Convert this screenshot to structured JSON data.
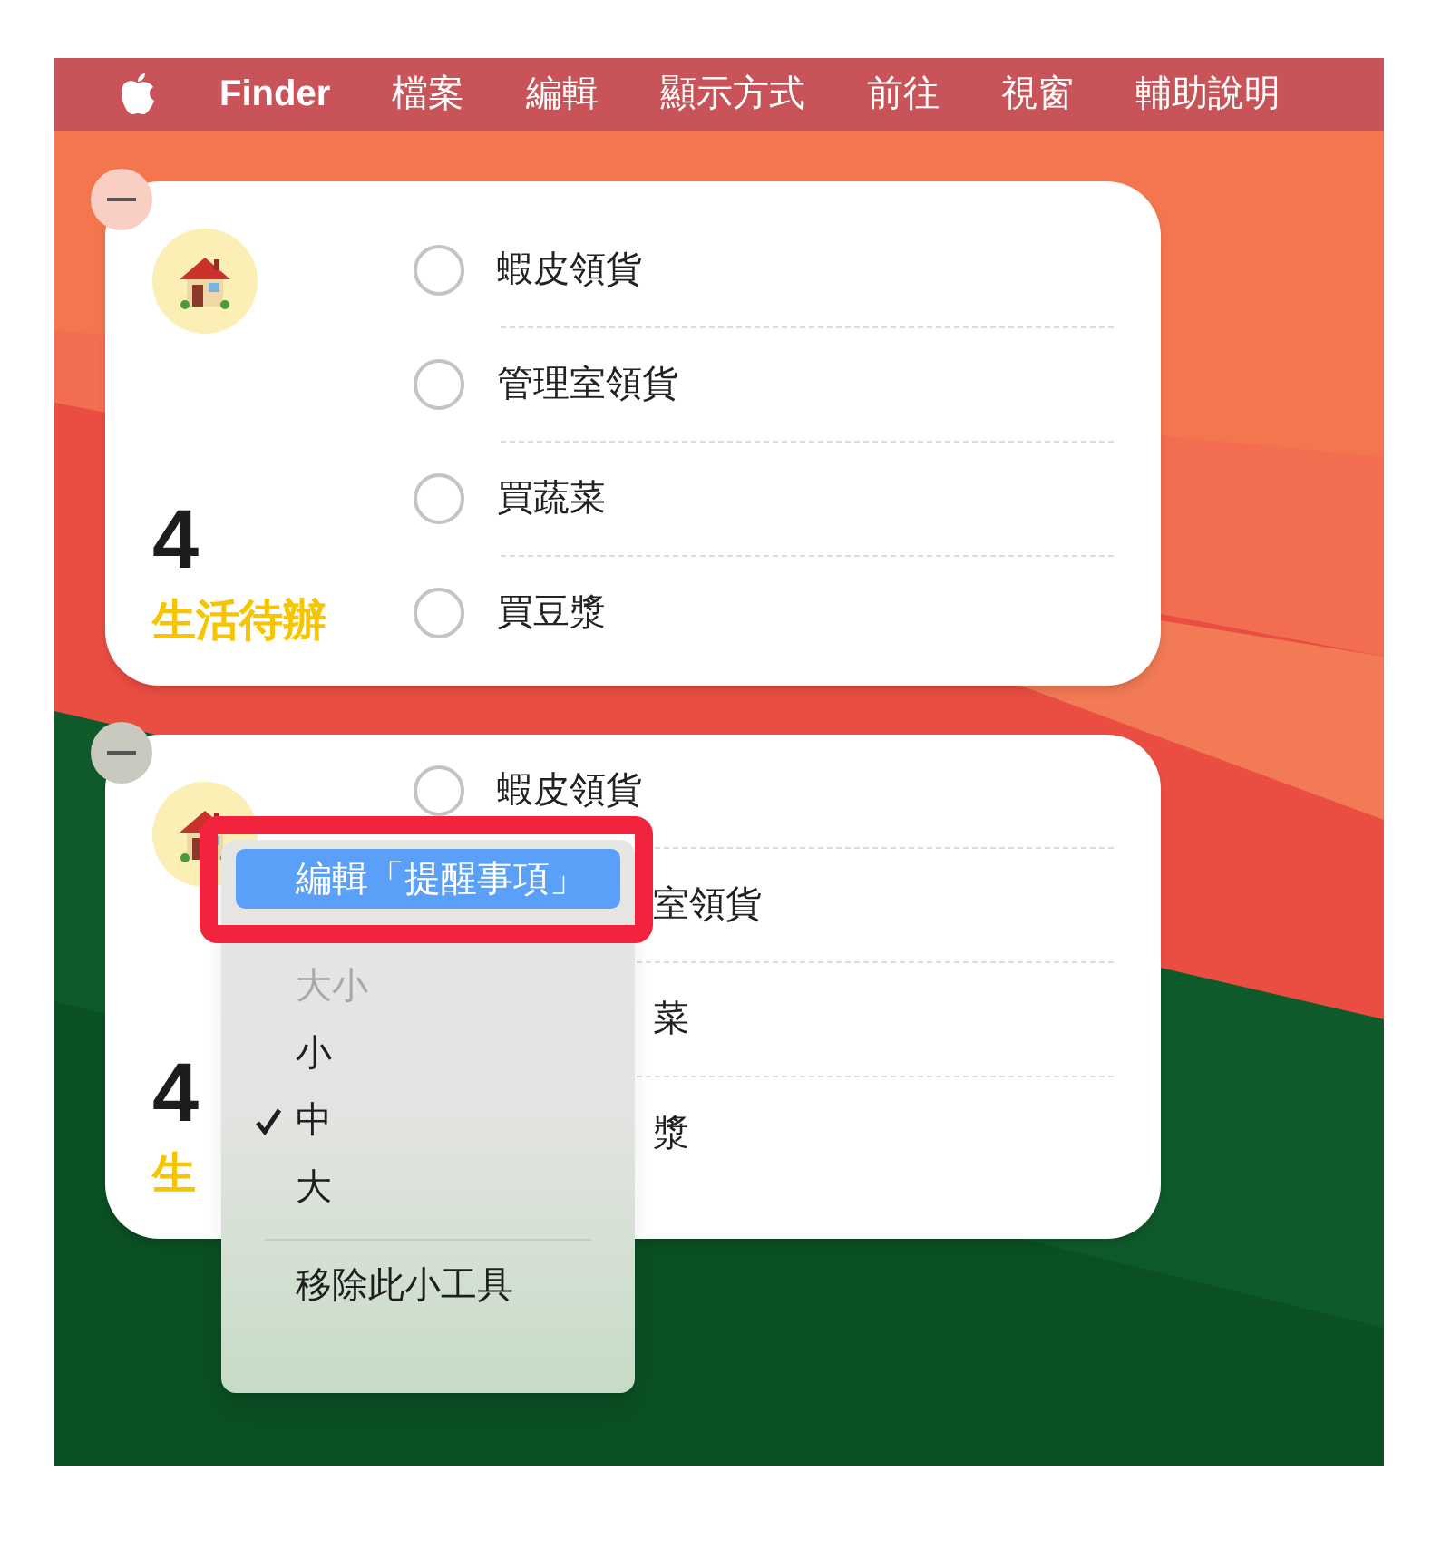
{
  "menu_bar": {
    "items": [
      {
        "label": "Finder",
        "bold": true
      },
      {
        "label": "檔案",
        "bold": false
      },
      {
        "label": "編輯",
        "bold": false
      },
      {
        "label": "顯示方式",
        "bold": false
      },
      {
        "label": "前往",
        "bold": false
      },
      {
        "label": "視窗",
        "bold": false
      },
      {
        "label": "輔助說明",
        "bold": false
      }
    ]
  },
  "widgets": [
    {
      "kind": "full",
      "count": "4",
      "title": "生活待辦",
      "items": [
        "蝦皮領貨",
        "管理室領貨",
        "買蔬菜",
        "買豆漿"
      ]
    },
    {
      "kind": "covered",
      "count": "4",
      "title": "生",
      "items": [
        "蝦皮領貨",
        "室領貨",
        "菜",
        "漿"
      ]
    }
  ],
  "context_menu": {
    "items": [
      {
        "kind": "action",
        "label": "編輯「提醒事項」",
        "selected": true,
        "checked": false,
        "disabled": false
      },
      {
        "kind": "header",
        "label": "大小",
        "selected": false,
        "checked": false,
        "disabled": true
      },
      {
        "kind": "option",
        "label": "小",
        "selected": false,
        "checked": false,
        "disabled": false
      },
      {
        "kind": "option",
        "label": "中",
        "selected": false,
        "checked": true,
        "disabled": false
      },
      {
        "kind": "option",
        "label": "大",
        "selected": false,
        "checked": false,
        "disabled": false
      },
      {
        "kind": "separator"
      },
      {
        "kind": "action",
        "label": "移除此小工具",
        "selected": false,
        "checked": false,
        "disabled": false
      }
    ]
  }
}
